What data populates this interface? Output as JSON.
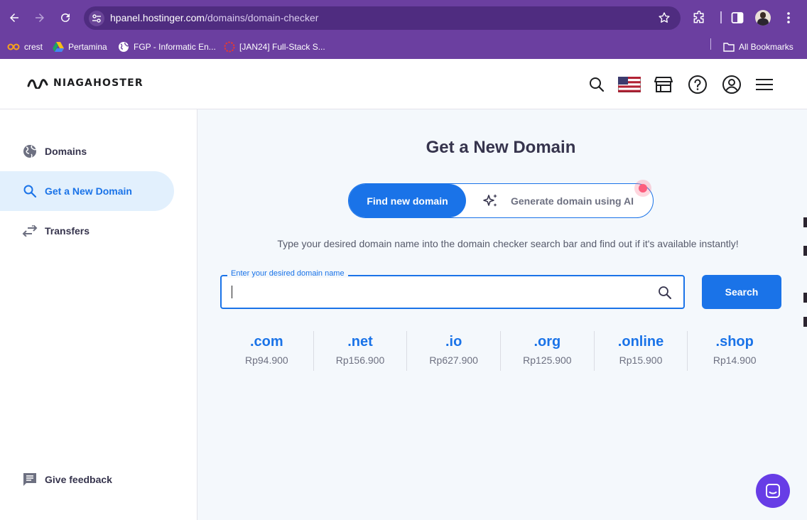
{
  "browser": {
    "url_host": "hpanel.hostinger.com",
    "url_path": "/domains/domain-checker",
    "bookmarks": [
      {
        "label": "crest",
        "icon": "crest-icon"
      },
      {
        "label": "Pertamina",
        "icon": "drive-icon"
      },
      {
        "label": "FGP - Informatic En...",
        "icon": "globe-icon"
      },
      {
        "label": "[JAN24] Full-Stack S...",
        "icon": "loading-ring-icon"
      }
    ],
    "all_bookmarks": "All Bookmarks"
  },
  "header": {
    "logo_text": "NIAGAHOSTER",
    "icons": [
      "search-icon",
      "us-flag-icon",
      "store-icon",
      "help-icon",
      "account-icon",
      "menu-icon"
    ]
  },
  "sidebar": {
    "items": [
      {
        "label": "Domains",
        "icon": "globe-icon",
        "active": false
      },
      {
        "label": "Get a New Domain",
        "icon": "search-icon",
        "active": true
      },
      {
        "label": "Transfers",
        "icon": "transfer-icon",
        "active": false
      }
    ],
    "feedback": "Give feedback"
  },
  "main": {
    "title": "Get a New Domain",
    "toggle": {
      "selected": "Find new domain",
      "other": "Generate domain using AI"
    },
    "description": "Type your desired domain name into the domain checker search bar and find out if it's available instantly!",
    "search": {
      "label": "Enter your desired domain name",
      "value": "",
      "button": "Search"
    },
    "tlds": [
      {
        "name": ".com",
        "price": "Rp94.900"
      },
      {
        "name": ".net",
        "price": "Rp156.900"
      },
      {
        "name": ".io",
        "price": "Rp627.900"
      },
      {
        "name": ".org",
        "price": "Rp125.900"
      },
      {
        "name": ".online",
        "price": "Rp15.900"
      },
      {
        "name": ".shop",
        "price": "Rp14.900"
      }
    ]
  },
  "colors": {
    "chrome": "#6b3fa0",
    "primary": "#1a73e8",
    "active_bg": "#e2f0fd",
    "chat": "#673de6",
    "notification_dot": "#fc5d7d"
  }
}
